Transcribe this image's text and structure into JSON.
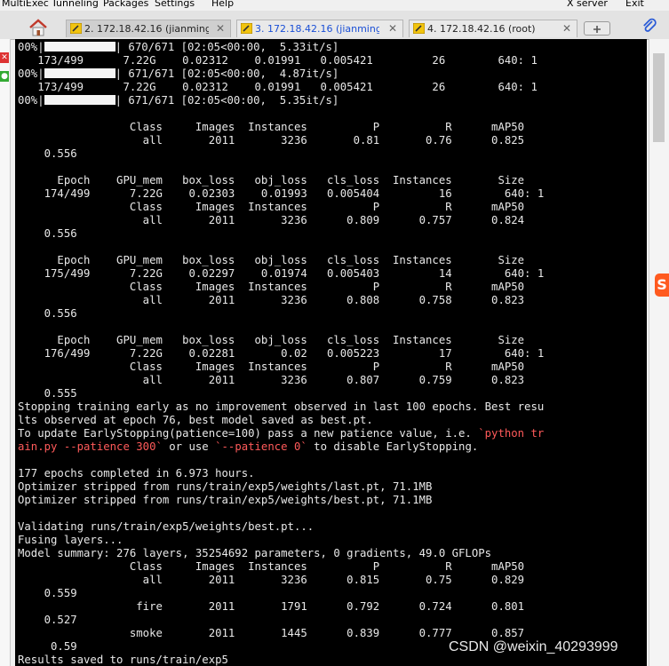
{
  "menubar": {
    "items": [
      {
        "label": "MultiExec"
      },
      {
        "label": "Tunneling"
      },
      {
        "label": "Packages"
      },
      {
        "label": "Settings"
      },
      {
        "label": "Help"
      },
      {
        "label": "X server"
      },
      {
        "label": "Exit"
      }
    ]
  },
  "tabs": [
    {
      "label": "2. 172.18.42.16 (jianming_",
      "icon": "terminal-icon",
      "active": true
    },
    {
      "label": "3. 172.18.42.16 (jianming_c",
      "icon": "terminal-icon",
      "active": false,
      "color": "#1a4fd6"
    },
    {
      "label": "4. 172.18.42.16 (root)",
      "icon": "terminal-icon",
      "active": false
    }
  ],
  "icons": {
    "home": "home-icon",
    "new_tab": "new-tab-icon",
    "attach": "paperclip-icon",
    "close": "close-icon",
    "sogou": "sogou-input-icon"
  },
  "colors": {
    "terminal_bg": "#000000",
    "terminal_fg": "#e8e8e8",
    "highlight": "#ff5a5a"
  },
  "terminal": {
    "lines": [
      {
        "text": "00%|          | 670/671 [02:05<00:00,  5.33it/s]"
      },
      {
        "text": "   173/499      7.22G    0.02312    0.01991   0.005421         26        640: 1"
      },
      {
        "text": "00%|          | 671/671 [02:05<00:00,  4.87it/s]"
      },
      {
        "text": "   173/499      7.22G    0.02312    0.01991   0.005421         26        640: 1"
      },
      {
        "text": "00%|          | 671/671 [02:05<00:00,  5.35it/s]"
      },
      {
        "text": ""
      },
      {
        "text": "                 Class     Images  Instances          P          R      mAP50"
      },
      {
        "text": "                   all       2011       3236       0.81       0.76      0.825"
      },
      {
        "text": "    0.556"
      },
      {
        "text": ""
      },
      {
        "text": "      Epoch    GPU_mem   box_loss   obj_loss   cls_loss  Instances       Size"
      },
      {
        "text": "    174/499      7.22G    0.02303    0.01993   0.005404         16        640: 1"
      },
      {
        "text": "                 Class     Images  Instances          P          R      mAP50"
      },
      {
        "text": "                   all       2011       3236      0.809      0.757      0.824"
      },
      {
        "text": "    0.556"
      },
      {
        "text": ""
      },
      {
        "text": "      Epoch    GPU_mem   box_loss   obj_loss   cls_loss  Instances       Size"
      },
      {
        "text": "    175/499      7.22G    0.02297    0.01974   0.005403         14        640: 1"
      },
      {
        "text": "                 Class     Images  Instances          P          R      mAP50"
      },
      {
        "text": "                   all       2011       3236      0.808      0.758      0.823"
      },
      {
        "text": "    0.556"
      },
      {
        "text": ""
      },
      {
        "text": "      Epoch    GPU_mem   box_loss   obj_loss   cls_loss  Instances       Size"
      },
      {
        "text": "    176/499      7.22G    0.02281       0.02   0.005223         17        640: 1"
      },
      {
        "text": "                 Class     Images  Instances          P          R      mAP50"
      },
      {
        "text": "                   all       2011       3236      0.807      0.759      0.823"
      },
      {
        "text": "    0.555"
      },
      {
        "text": "Stopping training early as no improvement observed in last 100 epochs. Best resu"
      },
      {
        "text": "lts observed at epoch 76, best model saved as best.pt."
      },
      {
        "text": "To update EarlyStopping(patience=100) pass a new patience value, i.e. ",
        "highlight": "`python tr"
      },
      {
        "text": "",
        "highlight": "ain.py --patience 300`",
        "tail": " or use ",
        "highlight2": "`--patience 0`",
        "tail2": " to disable EarlyStopping."
      },
      {
        "text": ""
      },
      {
        "text": "177 epochs completed in 6.973 hours."
      },
      {
        "text": "Optimizer stripped from runs/train/exp5/weights/last.pt, 71.1MB"
      },
      {
        "text": "Optimizer stripped from runs/train/exp5/weights/best.pt, 71.1MB"
      },
      {
        "text": ""
      },
      {
        "text": "Validating runs/train/exp5/weights/best.pt..."
      },
      {
        "text": "Fusing layers..."
      },
      {
        "text": "Model summary: 276 layers, 35254692 parameters, 0 gradients, 49.0 GFLOPs"
      },
      {
        "text": "                 Class     Images  Instances          P          R      mAP50"
      },
      {
        "text": "                   all       2011       3236      0.815       0.75      0.829"
      },
      {
        "text": "    0.559"
      },
      {
        "text": "                  fire       2011       1791      0.792      0.724      0.801"
      },
      {
        "text": "    0.527"
      },
      {
        "text": "                 smoke       2011       1445      0.839      0.777      0.857"
      },
      {
        "text": "     0.59"
      },
      {
        "text": "Results saved to runs/train/exp5"
      }
    ]
  },
  "watermark": "CSDN @weixin_40293999"
}
